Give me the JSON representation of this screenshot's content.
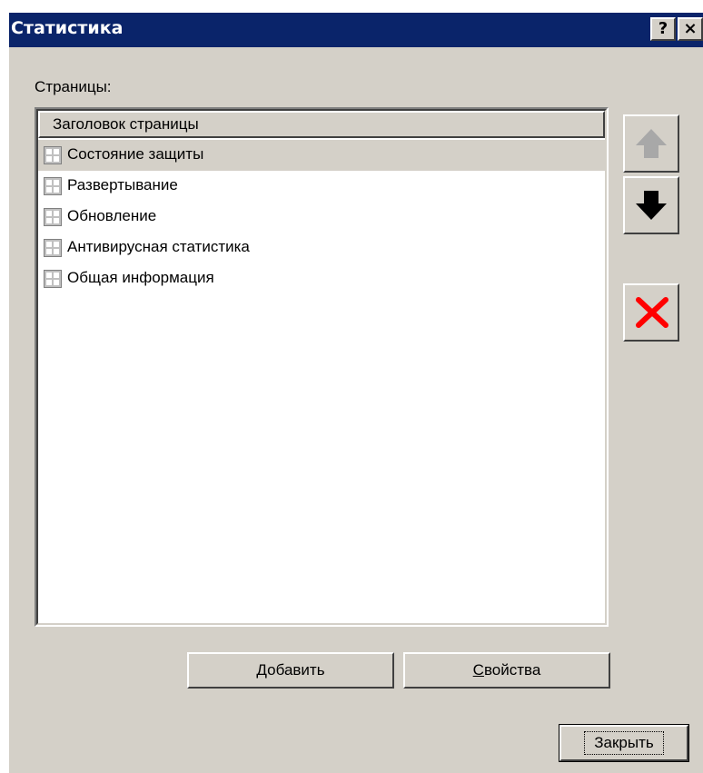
{
  "window": {
    "title": "Статистика",
    "help_label": "?",
    "close_label": "×"
  },
  "pages_label": "Страницы:",
  "list": {
    "column_header": "Заголовок страницы",
    "items": [
      {
        "label": "Состояние защиты",
        "selected": true
      },
      {
        "label": "Развертывание",
        "selected": false
      },
      {
        "label": "Обновление",
        "selected": false
      },
      {
        "label": "Антивирусная статистика",
        "selected": false
      },
      {
        "label": "Общая информация",
        "selected": false
      }
    ]
  },
  "side_buttons": {
    "up_icon": "arrow-up-icon",
    "down_icon": "arrow-down-icon",
    "delete_icon": "delete-icon"
  },
  "buttons": {
    "add_mnemonic": "Д",
    "add_rest": "обавить",
    "props_mnemonic": "С",
    "props_rest": "войства",
    "close_label": "Закрыть"
  },
  "colors": {
    "titlebar": "#0a246a",
    "dialog_bg": "#d4d0c8",
    "delete_red": "#ff0000",
    "disabled_arrow": "#a8a8a8"
  }
}
